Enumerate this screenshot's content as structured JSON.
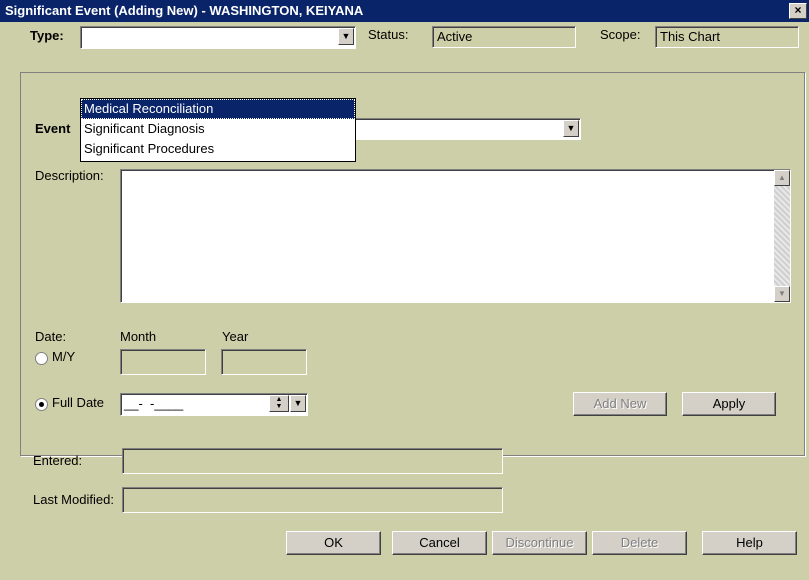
{
  "window": {
    "title": "Significant Event (Adding New) - WASHINGTON, KEIYANA",
    "close_glyph": "×"
  },
  "header": {
    "type_label": "Type:",
    "type_value": "",
    "status_label": "Status:",
    "status_value": "Active",
    "scope_label": "Scope:",
    "scope_value": "This Chart"
  },
  "type_dropdown": {
    "options": [
      "Medical Reconciliation",
      "Significant Diagnosis",
      "Significant Procedures"
    ],
    "selected_index": 0
  },
  "event": {
    "label": "Event",
    "value": ""
  },
  "description": {
    "label": "Description:",
    "value": ""
  },
  "date": {
    "label": "Date:",
    "month_label": "Month",
    "year_label": "Year",
    "my_label": "M/Y",
    "fulldate_label": "Full Date",
    "fulldate_mask": "__-  -____",
    "selected_mode": "Full Date"
  },
  "buttons_inner": {
    "add_new": "Add New",
    "apply": "Apply"
  },
  "entered": {
    "label": "Entered:",
    "value": ""
  },
  "last_modified": {
    "label": "Last Modified:",
    "value": ""
  },
  "buttons": {
    "ok": "OK",
    "cancel": "Cancel",
    "discontinue": "Discontinue",
    "delete": "Delete",
    "help": "Help"
  }
}
